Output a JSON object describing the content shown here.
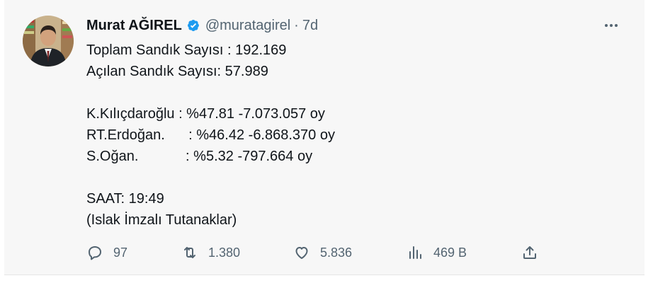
{
  "tweet": {
    "author": {
      "name": "Murat AĞIREL",
      "handle": "@muratagirel",
      "verified": true
    },
    "separator": "·",
    "timestamp": "7d",
    "lines": [
      "Toplam Sandık Sayısı : 192.169",
      "Açılan Sandık Sayısı: 57.989",
      "",
      "K.Kılıçdaroğlu : %47.81 -7.073.057 oy",
      "RT.Erdoğan.      : %46.42 -6.868.370 oy",
      "S.Oğan.            : %5.32 -797.664 oy",
      "",
      "SAAT: 19:49",
      "(Islak İmzalı Tutanaklar)"
    ],
    "stats": {
      "replies": "97",
      "retweets": "1.380",
      "likes": "5.836",
      "views": "469 B"
    }
  },
  "icons": {
    "verified": "verified-badge-icon",
    "more": "more-horizontal-icon",
    "reply": "reply-icon",
    "retweet": "retweet-icon",
    "like": "heart-icon",
    "views": "views-chart-icon",
    "share": "share-icon"
  },
  "colors": {
    "verified_blue": "#1d9bf0",
    "secondary_text": "#536471",
    "primary_text": "#0f1419",
    "background": "#f7f7f7"
  }
}
